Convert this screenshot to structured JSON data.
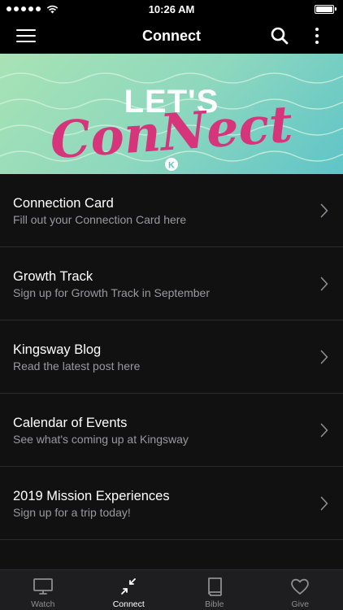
{
  "status_bar": {
    "time": "10:26 AM"
  },
  "nav": {
    "title": "Connect"
  },
  "banner": {
    "word_top": "LET'S",
    "word_script": "ConNect",
    "logo_letter": "K"
  },
  "items": [
    {
      "title": "Connection Card",
      "subtitle": "Fill out your Connection Card here"
    },
    {
      "title": "Growth Track",
      "subtitle": "Sign up for Growth Track in September"
    },
    {
      "title": "Kingsway Blog",
      "subtitle": "Read the latest post here"
    },
    {
      "title": "Calendar of Events",
      "subtitle": "See what's coming up at Kingsway"
    },
    {
      "title": "2019 Mission Experiences",
      "subtitle": "Sign up for a trip today!"
    }
  ],
  "tabs": [
    {
      "label": "Watch",
      "icon": "monitor-icon",
      "active": false
    },
    {
      "label": "Connect",
      "icon": "compress-arrows-icon",
      "active": true
    },
    {
      "label": "Bible",
      "icon": "book-icon",
      "active": false
    },
    {
      "label": "Give",
      "icon": "heart-icon",
      "active": false
    }
  ],
  "colors": {
    "accent": "#d6357c",
    "banner_top": "#a8e3b4",
    "banner_bottom": "#5fc4c8",
    "background": "#111112"
  }
}
